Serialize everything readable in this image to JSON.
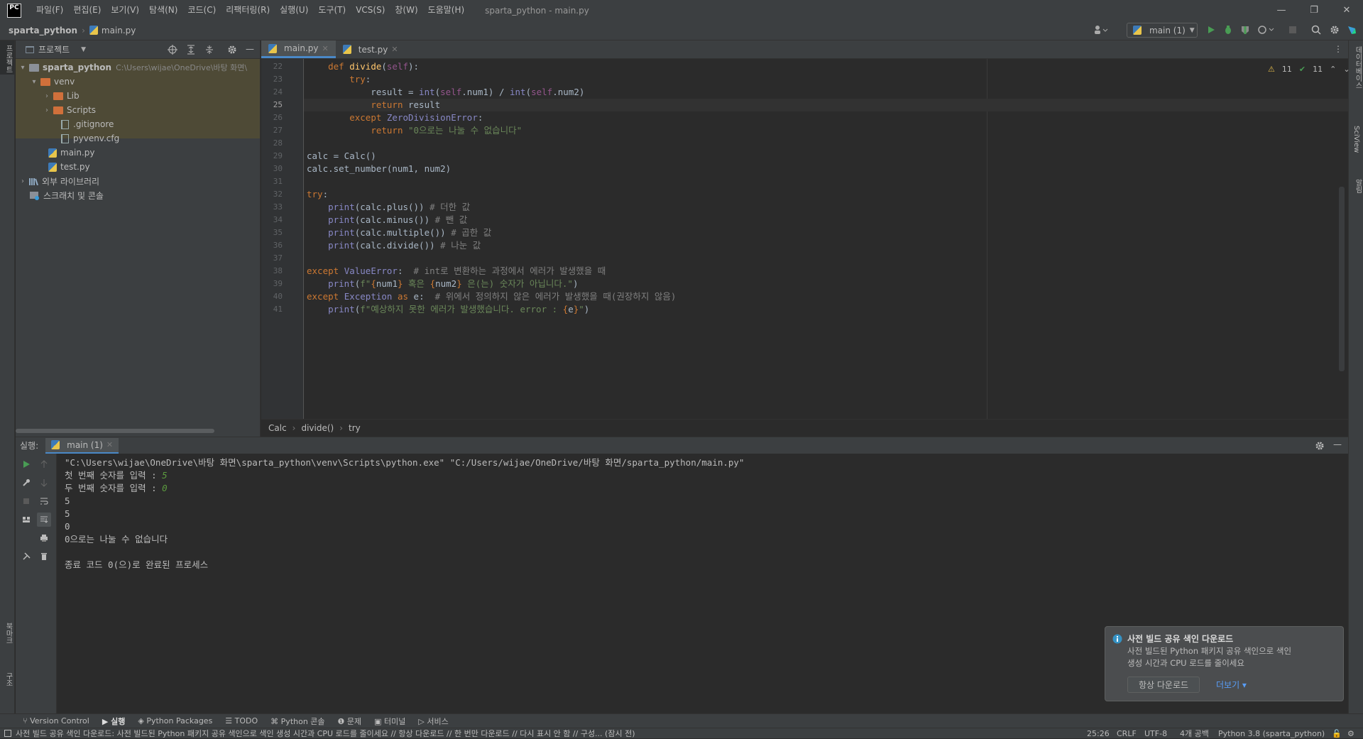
{
  "titlebar": {
    "logo": "PC",
    "menu": [
      "파일(F)",
      "편집(E)",
      "보기(V)",
      "탐색(N)",
      "코드(C)",
      "리팩터링(R)",
      "실행(U)",
      "도구(T)",
      "VCS(S)",
      "창(W)",
      "도움말(H)"
    ],
    "title": "sparta_python - main.py"
  },
  "navbar": {
    "project": "sparta_python",
    "file": "main.py",
    "run_config": "main (1)"
  },
  "left_strip": {
    "project_label": "프로젝트",
    "bookmarks_label": "북마크",
    "structure_label": "구조"
  },
  "right_strip": {
    "database_label": "데이터베이스",
    "sciview_label": "SciView",
    "notifications_label": "알림"
  },
  "project_panel": {
    "title": "프로젝트",
    "tree": [
      {
        "label": "sparta_python",
        "path": "C:\\Users\\wijae\\OneDrive\\바탕 화면\\"
      },
      {
        "label": "venv"
      },
      {
        "label": "Lib"
      },
      {
        "label": "Scripts"
      },
      {
        "label": ".gitignore"
      },
      {
        "label": "pyvenv.cfg"
      },
      {
        "label": "main.py"
      },
      {
        "label": "test.py"
      },
      {
        "label": "외부 라이브러리"
      },
      {
        "label": "스크래치 및 콘솔"
      }
    ]
  },
  "editor": {
    "tabs": [
      "main.py",
      "test.py"
    ],
    "inspections": {
      "warnings": "11",
      "ok": "11"
    },
    "breadcrumb": [
      "Calc",
      "divide()",
      "try"
    ]
  },
  "run_panel": {
    "label": "실행:",
    "tab": "main (1)",
    "output": [
      "\"C:\\Users\\wijae\\OneDrive\\바탕 화면\\sparta_python\\venv\\Scripts\\python.exe\" \"C:/Users/wijae/OneDrive/바탕 화면/sparta_python/main.py\"",
      "첫 번째 숫자를 입력 : ",
      "두 번째 숫자를 입력 : ",
      "5",
      "5",
      "0",
      "0으로는 나눌 수 없습니다",
      "",
      "종료 코드 0(으)로 완료된 프로세스"
    ],
    "input1": "5",
    "input2": "0"
  },
  "notification": {
    "title": "사전 빌드 공유 색인 다운로드",
    "body_line1": "사전 빌드된 Python 패키지 공유 색인으로 색인",
    "body_line2": "생성 시간과 CPU 로드를 줄이세요",
    "primary": "항상 다운로드",
    "more": "더보기 ▾"
  },
  "toolwindows": [
    "Version Control",
    "실행",
    "Python Packages",
    "TODO",
    "Python 콘솔",
    "문제",
    "터미널",
    "서비스"
  ],
  "statusbar": {
    "message": "사전 빌드 공유 색인 다운로드: 사전 빌드된 Python 패키지 공유 색인으로 색인 생성 시간과 CPU 로드를 줄이세요 // 항상 다운로드 // 한 번만 다운로드 // 다시 표시 안 함 // 구성... (잠시 전)",
    "position": "25:26",
    "line_sep": "CRLF",
    "encoding": "UTF-8",
    "indent": "4개 공백",
    "interpreter": "Python 3.8 (sparta_python)"
  },
  "code": {
    "lines": [
      {
        "n": "22",
        "t": "    def divide(self):"
      },
      {
        "n": "23",
        "t": "        try:"
      },
      {
        "n": "24",
        "t": "            result = int(self.num1) / int(self.num2)"
      },
      {
        "n": "25",
        "t": "            return result"
      },
      {
        "n": "26",
        "t": "        except ZeroDivisionError:"
      },
      {
        "n": "27",
        "t": "            return \"0으로는 나눌 수 없습니다\""
      },
      {
        "n": "28",
        "t": ""
      },
      {
        "n": "29",
        "t": "calc = Calc()"
      },
      {
        "n": "30",
        "t": "calc.set_number(num1, num2)"
      },
      {
        "n": "31",
        "t": ""
      },
      {
        "n": "32",
        "t": "try:"
      },
      {
        "n": "33",
        "t": "    print(calc.plus()) # 더한 값"
      },
      {
        "n": "34",
        "t": "    print(calc.minus()) # 뺀 값"
      },
      {
        "n": "35",
        "t": "    print(calc.multiple()) # 곱한 값"
      },
      {
        "n": "36",
        "t": "    print(calc.divide()) # 나눈 값"
      },
      {
        "n": "37",
        "t": ""
      },
      {
        "n": "38",
        "t": "except ValueError:  # int로 변환하는 과정에서 에러가 발생했을 때"
      },
      {
        "n": "39",
        "t": "    print(f\"{num1} 혹은 {num2} 은(는) 숫자가 아닙니다.\")"
      },
      {
        "n": "40",
        "t": "except Exception as e:  # 위에서 정의하지 않은 에러가 발생했을 때(권장하지 않음)"
      },
      {
        "n": "41",
        "t": "    print(f\"예상하지 못한 에러가 발생했습니다. error : {e}\")"
      }
    ]
  },
  "colors": {
    "accent": "#4a88c7",
    "background": "#2b2b2b",
    "panel": "#3c3f41",
    "highlight_folder": "#4e4a36"
  }
}
